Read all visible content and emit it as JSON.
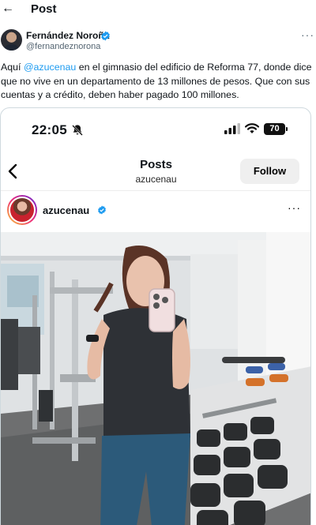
{
  "header": {
    "back_icon": "arrow-left-icon",
    "title": "Post"
  },
  "author": {
    "name": "Fernández Noroña",
    "handle": "@fernandeznorona",
    "verified_icon": "verified-badge-icon",
    "more_icon": "more-horizontal-icon"
  },
  "tweet": {
    "prefix": "Aquí ",
    "mention": "@azucenau",
    "suffix": " en el gimnasio del edificio de Reforma 77, donde dice que no vive en un departamento de 13 millones de pesos. Que con sus cuentas y a crédito, deben haber pagado 100 millones."
  },
  "embedded_screenshot": {
    "status_bar": {
      "time": "22:05",
      "battery": "70",
      "silent_icon": "bell-slash-icon",
      "signal_icon": "cellular-signal-icon",
      "wifi_icon": "wifi-icon"
    },
    "ig_header": {
      "back_icon": "chevron-left-icon",
      "title": "Posts",
      "subtitle": "azucenau",
      "follow_label": "Follow"
    },
    "post": {
      "username": "azucenau",
      "verified_icon": "verified-badge-icon",
      "more_icon": "more-horizontal-icon",
      "photo_desc_icon": "gym-selfie-photo"
    }
  },
  "colors": {
    "link": "#1d9bf0",
    "text": "#0f1419",
    "muted": "#536471",
    "verified": "#1d9bf0"
  }
}
